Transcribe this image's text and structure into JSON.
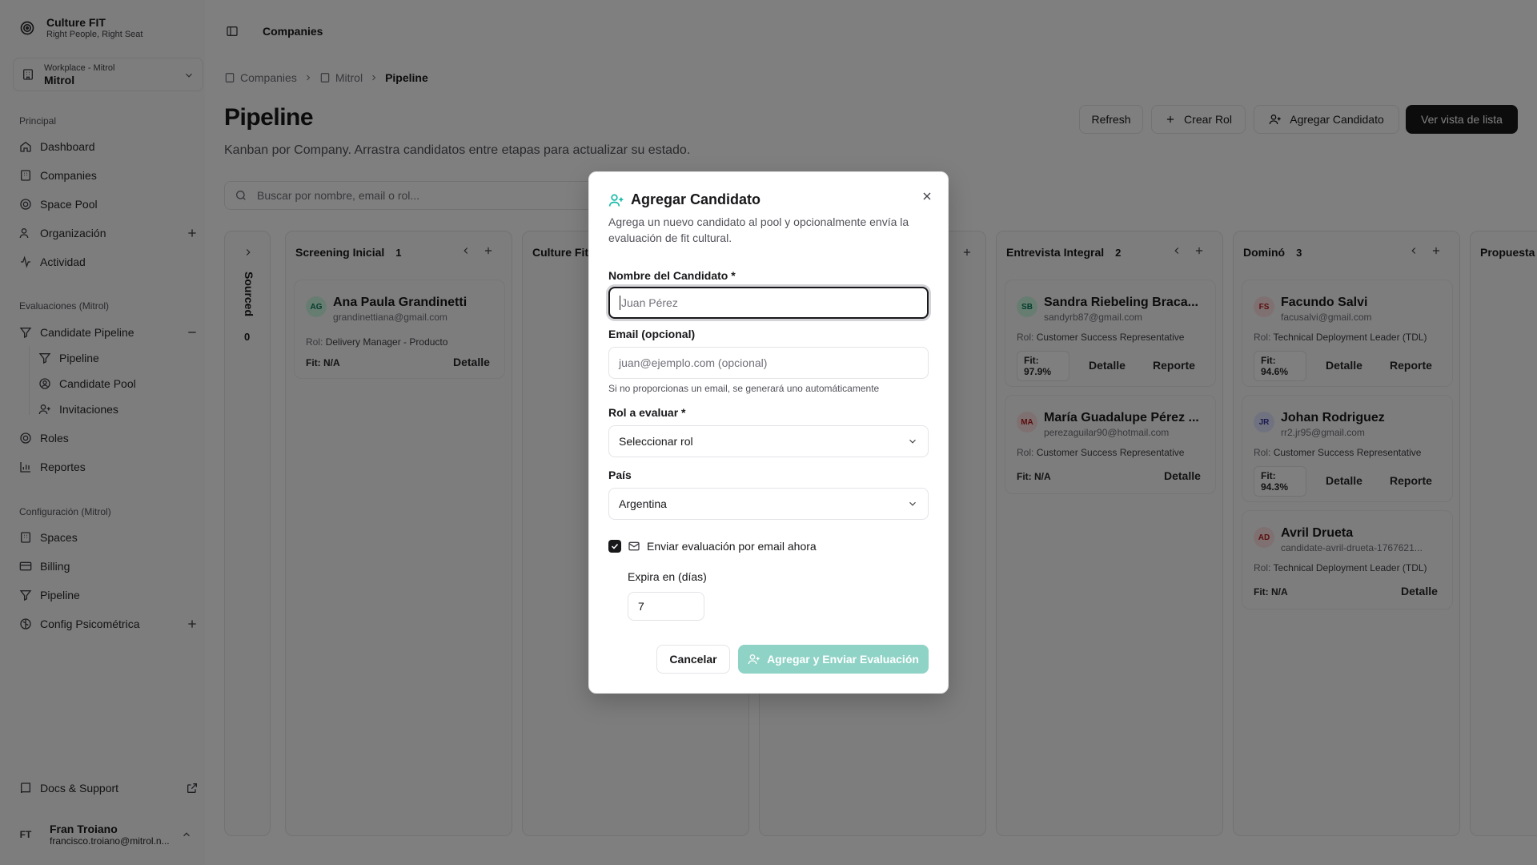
{
  "sidebar": {
    "brand": {
      "title": "Culture FIT",
      "subtitle": "Right People, Right Seat"
    },
    "workspace": {
      "label": "Workplace - Mitrol",
      "name": "Mitrol"
    },
    "group_principal": "Principal",
    "principal_items": [
      "Dashboard",
      "Companies",
      "Space Pool",
      "Organización",
      "Actividad"
    ],
    "group_eval": "Evaluaciones (Mitrol)",
    "eval_parent": "Candidate Pipeline",
    "eval_sub": [
      "Pipeline",
      "Candidate Pool",
      "Invitaciones"
    ],
    "eval_items": [
      "Roles",
      "Reportes"
    ],
    "group_config": "Configuración (Mitrol)",
    "config_items": [
      "Spaces",
      "Billing",
      "Pipeline",
      "Config Psicométrica"
    ],
    "docs": "Docs & Support",
    "user": {
      "initials": "FT",
      "name": "Fran Troiano",
      "email": "francisco.troiano@mitrol.n..."
    }
  },
  "topbar": {
    "title": "Companies"
  },
  "breadcrumb": [
    "Companies",
    "Mitrol",
    "Pipeline"
  ],
  "page": {
    "title": "Pipeline",
    "subtitle": "Kanban por Company. Arrastra candidatos entre etapas para actualizar su estado.",
    "buttons": {
      "refresh": "Refresh",
      "create_role": "Crear Rol",
      "add_candidate": "Agregar Candidato",
      "list_view": "Ver vista de lista"
    },
    "search_placeholder": "Buscar por nombre, email o rol..."
  },
  "board": {
    "collapsed": {
      "label": "Sourced",
      "count": "0"
    },
    "role_prefix": "Rol:",
    "detail_label": "Detalle",
    "report_label": "Reporte",
    "columns": [
      {
        "title": "Screening Inicial",
        "count": "1",
        "cards": [
          {
            "initials": "AG",
            "name": "Ana Paula Grandinetti",
            "email": "grandinettiana@gmail.com",
            "role": "Delivery Manager - Producto",
            "fit": "Fit: N/A"
          }
        ]
      },
      {
        "title": "Culture Fit",
        "count": ""
      },
      {
        "title": "",
        "count": ""
      },
      {
        "title": "Entrevista Integral",
        "count": "2",
        "cards": [
          {
            "initials": "SB",
            "name": "Sandra Riebeling Braca...",
            "email": "sandyrb87@gmail.com",
            "role": "Customer Success Representative",
            "fit": "Fit: 97.9%"
          },
          {
            "initials": "MA",
            "name": "María Guadalupe Pérez ...",
            "email": "perezaguilar90@hotmail.com",
            "role": "Customer Success Representative",
            "fit": "Fit: N/A"
          }
        ]
      },
      {
        "title": "Dominó",
        "count": "3",
        "cards": [
          {
            "initials": "FS",
            "name": "Facundo Salvi",
            "email": "facusalvi@gmail.com",
            "role": "Technical Deployment Leader (TDL)",
            "fit": "Fit: 94.6%"
          },
          {
            "initials": "JR",
            "name": "Johan Rodriguez",
            "email": "rr2.jr95@gmail.com",
            "role": "Customer Success Representative",
            "fit": "Fit: 94.3%"
          },
          {
            "initials": "AD",
            "name": "Avril Drueta",
            "email": "candidate-avril-drueta-1767621...",
            "role": "Technical Deployment Leader (TDL)",
            "fit": "Fit: N/A"
          }
        ]
      },
      {
        "title": "Propuesta",
        "count": ""
      }
    ]
  },
  "dialog": {
    "title": "Agregar Candidato",
    "description": "Agrega un nuevo candidato al pool y opcionalmente envía la evaluación de fit cultural.",
    "name_label": "Nombre del Candidato *",
    "name_placeholder": "Juan Pérez",
    "email_label": "Email (opcional)",
    "email_placeholder": "juan@ejemplo.com (opcional)",
    "email_hint": "Si no proporcionas un email, se generará uno automáticamente",
    "role_label": "Rol a evaluar *",
    "role_value": "Seleccionar rol",
    "country_label": "País",
    "country_value": "Argentina",
    "send_label": "Enviar evaluación por email ahora",
    "send_checked": true,
    "expires_label": "Expira en (días)",
    "expires_value": "7",
    "cancel": "Cancelar",
    "submit": "Agregar y Enviar Evaluación",
    "accent": "#8fd3c6"
  }
}
